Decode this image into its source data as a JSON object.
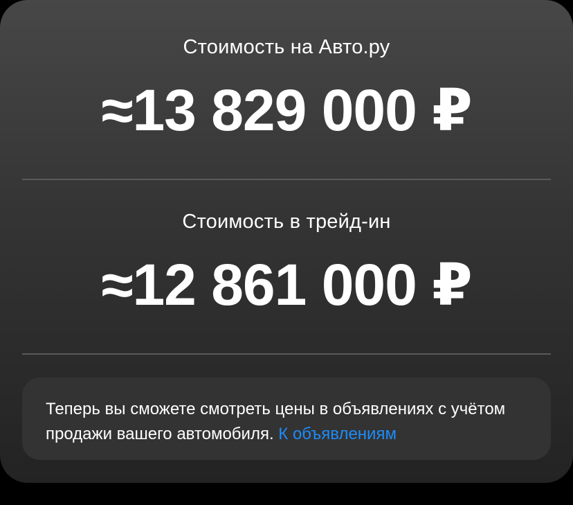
{
  "autoru": {
    "label": "Стоимость на Авто.ру",
    "price": "≈13 829 000 ₽"
  },
  "tradein": {
    "label": "Стоимость в трейд-ин",
    "price": "≈12 861 000 ₽"
  },
  "info": {
    "text": "Теперь вы сможете смотреть цены в объявлениях с учётом продажи вашего автомобиля.",
    "link_label": "К объявлениям"
  },
  "colors": {
    "link": "#1d8cf8",
    "text": "#ffffff"
  }
}
